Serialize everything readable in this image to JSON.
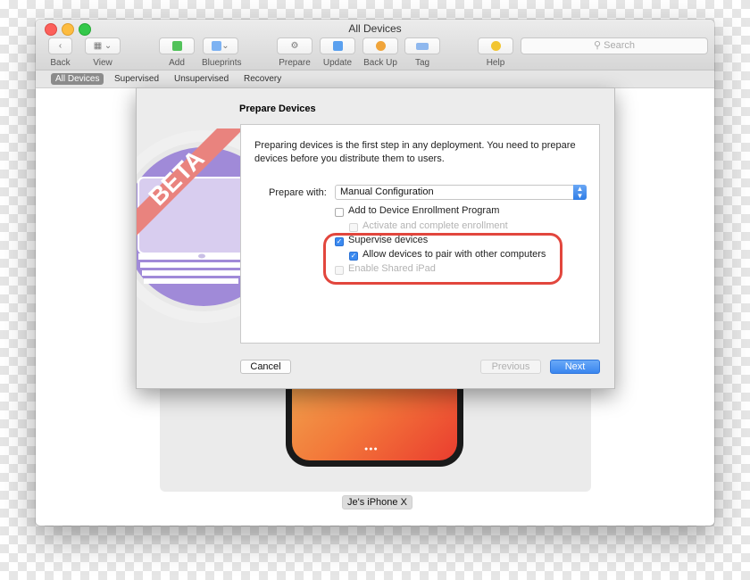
{
  "window": {
    "title": "All Devices"
  },
  "toolbar": {
    "back": "Back",
    "view": "View",
    "add": "Add",
    "blueprints": "Blueprints",
    "prepare": "Prepare",
    "update": "Update",
    "backup": "Back Up",
    "tag": "Tag",
    "help": "Help",
    "search_placeholder": "Search"
  },
  "scope_bar": [
    "All Devices",
    "Supervised",
    "Unsupervised",
    "Recovery"
  ],
  "device": {
    "name": "Je's iPhone X"
  },
  "sheet": {
    "title": "Prepare Devices",
    "badge": "BETA",
    "intro": "Preparing devices is the first step in any deployment. You need to prepare devices before you distribute them to users.",
    "prepare_with_label": "Prepare with:",
    "prepare_with_value": "Manual Configuration",
    "options": {
      "add_dep": {
        "label": "Add to Device Enrollment Program",
        "checked": false
      },
      "activate": {
        "label": "Activate and complete enrollment",
        "enabled": false
      },
      "supervise": {
        "label": "Supervise devices",
        "checked": true
      },
      "allow_pair": {
        "label": "Allow devices to pair with other computers",
        "checked": true
      },
      "shared_ipad": {
        "label": "Enable Shared iPad",
        "enabled": false
      }
    },
    "buttons": {
      "cancel": "Cancel",
      "previous": "Previous",
      "next": "Next"
    }
  },
  "colors": {
    "accent": "#3b8af0",
    "highlight": "#e2463d"
  }
}
